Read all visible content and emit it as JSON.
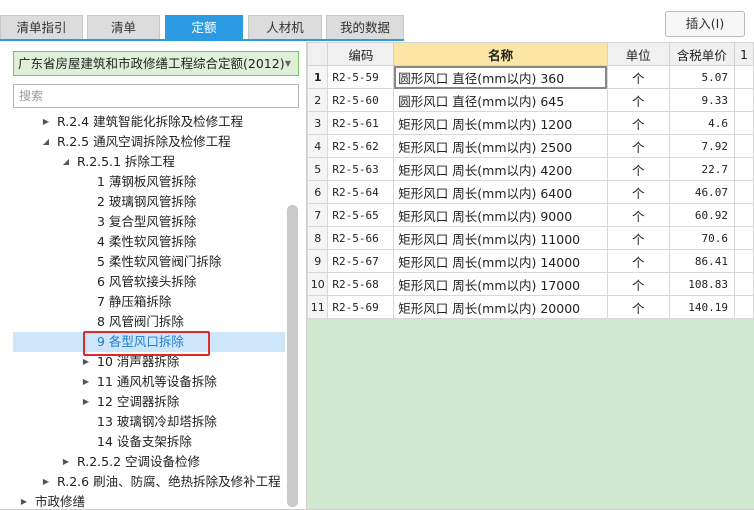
{
  "tabs": [
    {
      "label": "清单指引",
      "active": false
    },
    {
      "label": "清单",
      "active": false
    },
    {
      "label": "定额",
      "active": true
    },
    {
      "label": "人材机",
      "active": false
    },
    {
      "label": "我的数据",
      "active": false
    }
  ],
  "toolbar": {
    "insert_label": "插入(I)"
  },
  "quota_library": {
    "selected": "广东省房屋建筑和市政修缮工程综合定额(2012)"
  },
  "search": {
    "placeholder": "搜索"
  },
  "tree": [
    {
      "label": "R.2.4 建筑智能化拆除及检修工程",
      "level": 1,
      "expander": "collapsed"
    },
    {
      "label": "R.2.5 通风空调拆除及检修工程",
      "level": 1,
      "expander": "expanded"
    },
    {
      "label": "R.2.5.1 拆除工程",
      "level": 2,
      "expander": "expanded"
    },
    {
      "label": "1 薄钢板风管拆除",
      "level": 3,
      "expander": "none"
    },
    {
      "label": "2 玻璃钢风管拆除",
      "level": 3,
      "expander": "none"
    },
    {
      "label": "3 复合型风管拆除",
      "level": 3,
      "expander": "none"
    },
    {
      "label": "4 柔性软风管拆除",
      "level": 3,
      "expander": "none"
    },
    {
      "label": "5 柔性软风管阀门拆除",
      "level": 3,
      "expander": "none"
    },
    {
      "label": "6 风管软接头拆除",
      "level": 3,
      "expander": "none"
    },
    {
      "label": "7 静压箱拆除",
      "level": 3,
      "expander": "none"
    },
    {
      "label": "8 风管阀门拆除",
      "level": 3,
      "expander": "none"
    },
    {
      "label": "9 各型风口拆除",
      "level": 3,
      "expander": "none",
      "selected": true
    },
    {
      "label": "10 消声器拆除",
      "level": 3,
      "expander": "collapsed"
    },
    {
      "label": "11 通风机等设备拆除",
      "level": 3,
      "expander": "collapsed"
    },
    {
      "label": "12 空调器拆除",
      "level": 3,
      "expander": "collapsed"
    },
    {
      "label": "13 玻璃钢冷却塔拆除",
      "level": 3,
      "expander": "none"
    },
    {
      "label": "14 设备支架拆除",
      "level": 3,
      "expander": "none"
    },
    {
      "label": "R.2.5.2 空调设备检修",
      "level": 2,
      "expander": "collapsed"
    },
    {
      "label": "R.2.6 刷油、防腐、绝热拆除及修补工程",
      "level": 1,
      "expander": "collapsed"
    },
    {
      "label": "市政修缮",
      "level": 0,
      "expander": "collapsed"
    }
  ],
  "grid": {
    "headers": {
      "code": "编码",
      "name": "名称",
      "unit": "单位",
      "price": "含税单价",
      "extra": "1"
    },
    "rows": [
      {
        "no": "1",
        "code": "R2-5-59",
        "name": "圆形风口 直径(mm以内) 360",
        "unit": "个",
        "price": "5.07"
      },
      {
        "no": "2",
        "code": "R2-5-60",
        "name": "圆形风口 直径(mm以内) 645",
        "unit": "个",
        "price": "9.33"
      },
      {
        "no": "3",
        "code": "R2-5-61",
        "name": "矩形风口 周长(mm以内) 1200",
        "unit": "个",
        "price": "4.6"
      },
      {
        "no": "4",
        "code": "R2-5-62",
        "name": "矩形风口 周长(mm以内) 2500",
        "unit": "个",
        "price": "7.92"
      },
      {
        "no": "5",
        "code": "R2-5-63",
        "name": "矩形风口 周长(mm以内) 4200",
        "unit": "个",
        "price": "22.7"
      },
      {
        "no": "6",
        "code": "R2-5-64",
        "name": "矩形风口 周长(mm以内) 6400",
        "unit": "个",
        "price": "46.07"
      },
      {
        "no": "7",
        "code": "R2-5-65",
        "name": "矩形风口 周长(mm以内) 9000",
        "unit": "个",
        "price": "60.92"
      },
      {
        "no": "8",
        "code": "R2-5-66",
        "name": "矩形风口 周长(mm以内) 11000",
        "unit": "个",
        "price": "70.6"
      },
      {
        "no": "9",
        "code": "R2-5-67",
        "name": "矩形风口 周长(mm以内) 14000",
        "unit": "个",
        "price": "86.41"
      },
      {
        "no": "10",
        "code": "R2-5-68",
        "name": "矩形风口 周长(mm以内) 17000",
        "unit": "个",
        "price": "108.83"
      },
      {
        "no": "11",
        "code": "R2-5-69",
        "name": "矩形风口 周长(mm以内) 20000",
        "unit": "个",
        "price": "140.19"
      }
    ]
  },
  "colors": {
    "accent": "#2c9be3",
    "selection_outline": "#e0292a",
    "grid_empty": "#cfe8cf"
  }
}
